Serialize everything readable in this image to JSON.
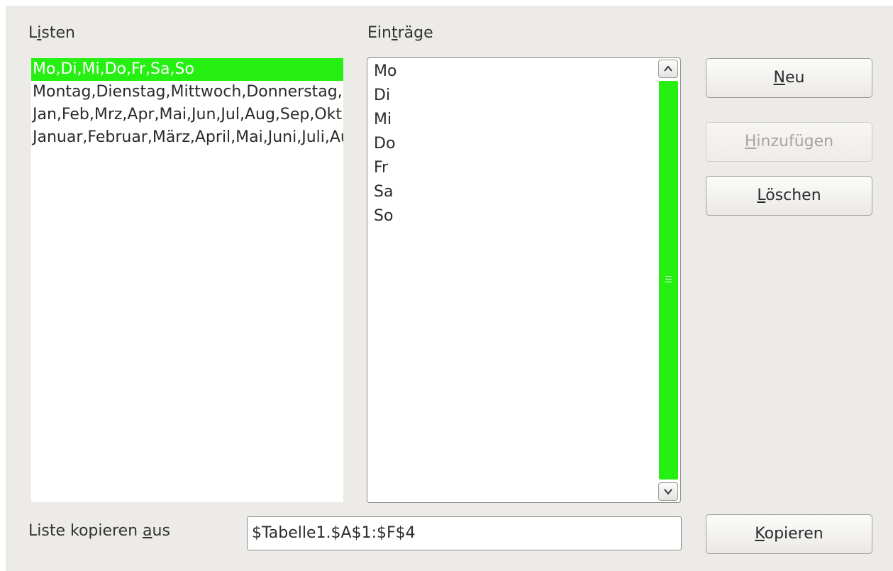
{
  "labels": {
    "lists_pre": "L",
    "lists_mn": "i",
    "lists_post": "sten",
    "entries_pre": "Ein",
    "entries_mn": "t",
    "entries_post": "räge",
    "copy_from_pre": "Liste kopieren ",
    "copy_from_mn": "a",
    "copy_from_post": "us"
  },
  "lists": [
    "Mo,Di,Mi,Do,Fr,Sa,So",
    "Montag,Dienstag,Mittwoch,Donnerstag,Freitag,Samstag,Sonntag",
    "Jan,Feb,Mrz,Apr,Mai,Jun,Jul,Aug,Sep,Okt,Nov,Dez",
    "Januar,Februar,März,April,Mai,Juni,Juli,August,September,Oktober,November,Dezember"
  ],
  "selected_list_index": 0,
  "entries": [
    "Mo",
    "Di",
    "Mi",
    "Do",
    "Fr",
    "Sa",
    "So"
  ],
  "buttons": {
    "new_mn": "N",
    "new_rest": "eu",
    "add_mn": "H",
    "add_rest": "inzufügen",
    "delete_mn": "L",
    "delete_rest": "öschen",
    "copy_mn": "K",
    "copy_rest": "opieren"
  },
  "copy_from_value": "$Tabelle1.$A$1:$F$4",
  "colors": {
    "selection": "#26f012",
    "dialog_bg": "#edebe8"
  }
}
